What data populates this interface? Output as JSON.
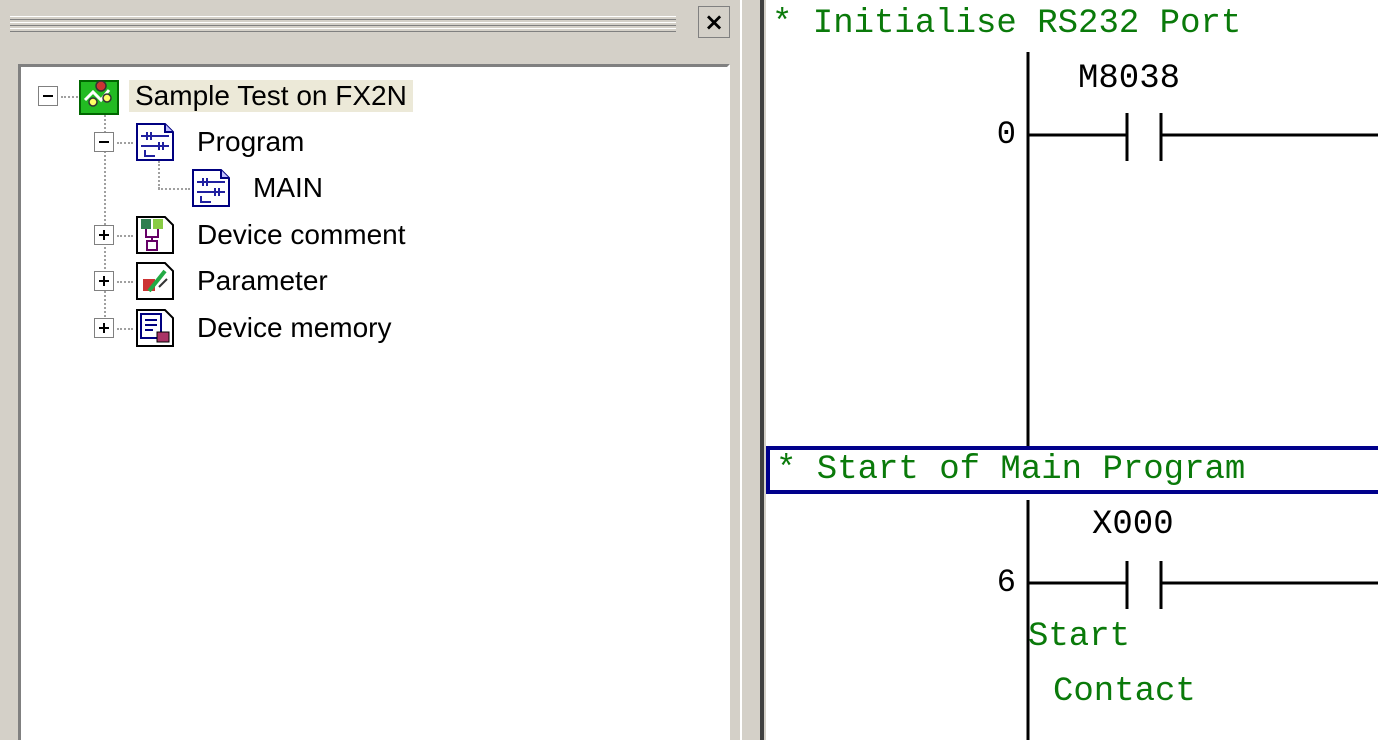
{
  "project_tree": {
    "root": {
      "label": "Sample Test on FX2N",
      "icon": "project-icon",
      "expanded": true,
      "selected": true
    },
    "items": [
      {
        "label": "Program",
        "icon": "program-icon",
        "expanded": true,
        "children": [
          {
            "label": "MAIN",
            "icon": "program-icon"
          }
        ]
      },
      {
        "label": "Device comment",
        "icon": "device-comment-icon",
        "expanded": false
      },
      {
        "label": "Parameter",
        "icon": "parameter-icon",
        "expanded": false
      },
      {
        "label": "Device memory",
        "icon": "device-memory-icon",
        "expanded": false
      }
    ],
    "close_glyph": "×"
  },
  "ladder": {
    "rungs": [
      {
        "comment": "* Initialise RS232 Port",
        "step": "0",
        "contact_device": "M8038",
        "contact_comment": []
      },
      {
        "comment": "* Start of Main Program",
        "step": "6",
        "contact_device": "X000",
        "contact_comment": [
          "Start",
          "Contact"
        ],
        "selected": true
      }
    ],
    "colors": {
      "comment": "#0a7a0a",
      "selection": "#00008b"
    }
  }
}
